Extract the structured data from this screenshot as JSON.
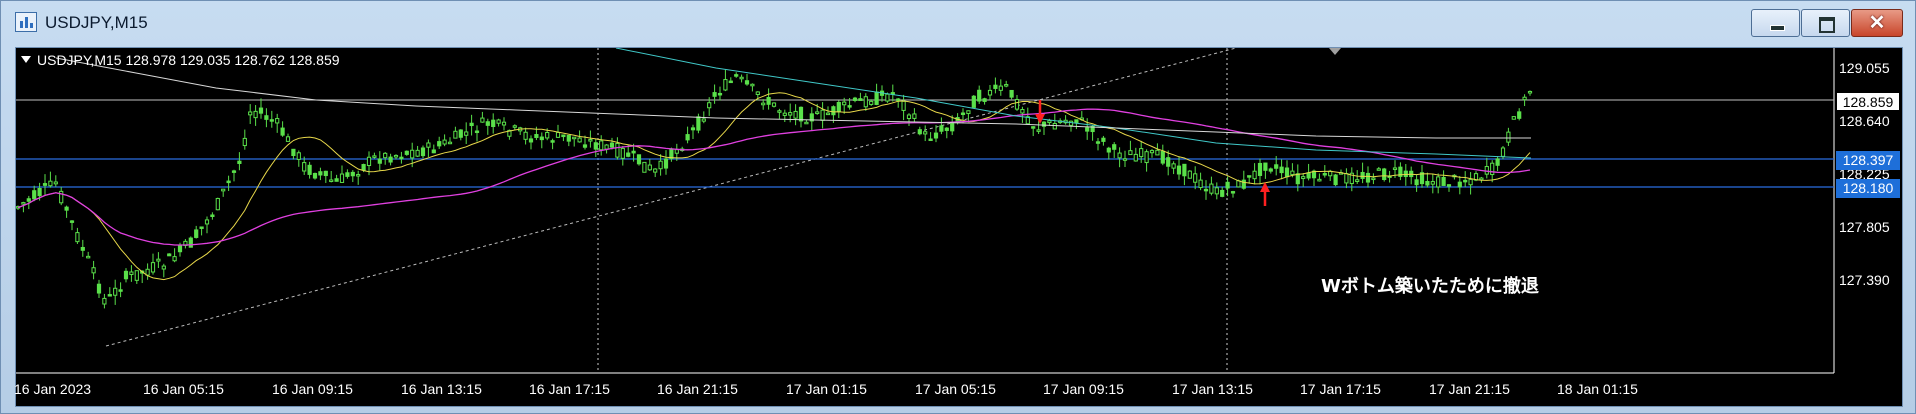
{
  "window": {
    "title": "USDJPY,M15",
    "min_label": "",
    "max_label": "",
    "close_label": "✕"
  },
  "chart": {
    "symbol_line": "USDJPY,M15  128.978 129.035 128.762 128.859",
    "annotation": "Wボトム築いたために撤退",
    "bid_price": "128.859",
    "hline_upper": "128.397",
    "hline_lower": "128.180",
    "price_ticks": [
      "129.055",
      "128.640",
      "128.225",
      "127.805",
      "127.390"
    ],
    "time_ticks": [
      "16 Jan 2023",
      "16 Jan 05:15",
      "16 Jan 09:15",
      "16 Jan 13:15",
      "16 Jan 17:15",
      "16 Jan 21:15",
      "17 Jan 01:15",
      "17 Jan 05:15",
      "17 Jan 09:15",
      "17 Jan 13:15",
      "17 Jan 17:15",
      "17 Jan 21:15",
      "18 Jan 01:15"
    ],
    "colors": {
      "background": "#000000",
      "candle": "#5ae04a",
      "ma_yellow": "#e8d84a",
      "ma_magenta": "#e040e0",
      "ma_cyan": "#40c8c8",
      "ma_white": "#d8d8d8",
      "hline_blue": "#2a6ee0",
      "arrow": "#ff2020"
    },
    "icons": {
      "app": "chart-window-icon",
      "collapse": "triangle-down-icon",
      "signal": "arrow-icon"
    }
  }
}
